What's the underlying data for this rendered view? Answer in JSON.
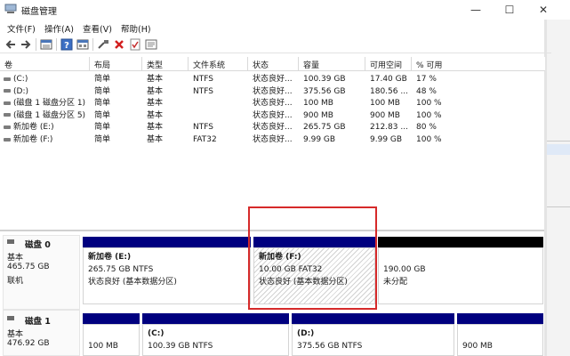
{
  "window": {
    "title": "磁盘管理"
  },
  "menu": [
    "文件(F)",
    "操作(A)",
    "查看(V)",
    "帮助(H)"
  ],
  "toolbar_icons": [
    "back-arrow-icon",
    "forward-arrow-icon",
    "list-view-icon",
    "help-icon",
    "console-icon",
    "connect-icon",
    "delete-icon",
    "check-icon",
    "properties-icon"
  ],
  "table": {
    "headers": [
      "卷",
      "布局",
      "类型",
      "文件系统",
      "状态",
      "容量",
      "可用空间",
      "% 可用"
    ],
    "rows": [
      [
        "(C:)",
        "简单",
        "基本",
        "NTFS",
        "状态良好...",
        "100.39 GB",
        "17.40 GB",
        "17 %"
      ],
      [
        "(D:)",
        "简单",
        "基本",
        "NTFS",
        "状态良好...",
        "375.56 GB",
        "180.56 ...",
        "48 %"
      ],
      [
        "(磁盘 1 磁盘分区 1)",
        "简单",
        "基本",
        "",
        "状态良好...",
        "100 MB",
        "100 MB",
        "100 %"
      ],
      [
        "(磁盘 1 磁盘分区 5)",
        "简单",
        "基本",
        "",
        "状态良好...",
        "900 MB",
        "900 MB",
        "100 %"
      ],
      [
        "新加卷 (E:)",
        "简单",
        "基本",
        "NTFS",
        "状态良好...",
        "265.75 GB",
        "212.83 ...",
        "80 %"
      ],
      [
        "新加卷 (F:)",
        "简单",
        "基本",
        "FAT32",
        "状态良好...",
        "9.99 GB",
        "9.99 GB",
        "100 %"
      ]
    ]
  },
  "disks": [
    {
      "title": "磁盘 0",
      "type": "基本",
      "size": "465.75 GB",
      "status": "联机",
      "partitions": [
        {
          "name": "新加卷 (E:)",
          "size": "265.75 GB NTFS",
          "status": "状态良好 (基本数据分区)"
        },
        {
          "name": "新加卷 (F:)",
          "size": "10.00 GB FAT32",
          "status": "状态良好 (基本数据分区)"
        },
        {
          "name": "",
          "size": "190.00 GB",
          "status": "未分配"
        }
      ]
    },
    {
      "title": "磁盘 1",
      "type": "基本",
      "size": "476.92 GB",
      "status": "",
      "partitions": [
        {
          "name": "",
          "size": "100 MB",
          "status": ""
        },
        {
          "name": "(C:)",
          "size": "100.39 GB NTFS",
          "status": ""
        },
        {
          "name": "(D:)",
          "size": "375.56 GB NTFS",
          "status": ""
        },
        {
          "name": "",
          "size": "900 MB",
          "status": ""
        }
      ]
    }
  ],
  "colors": {
    "primary_partition": "#00007f",
    "unallocated": "#000000",
    "highlight": "#d62a2a"
  }
}
